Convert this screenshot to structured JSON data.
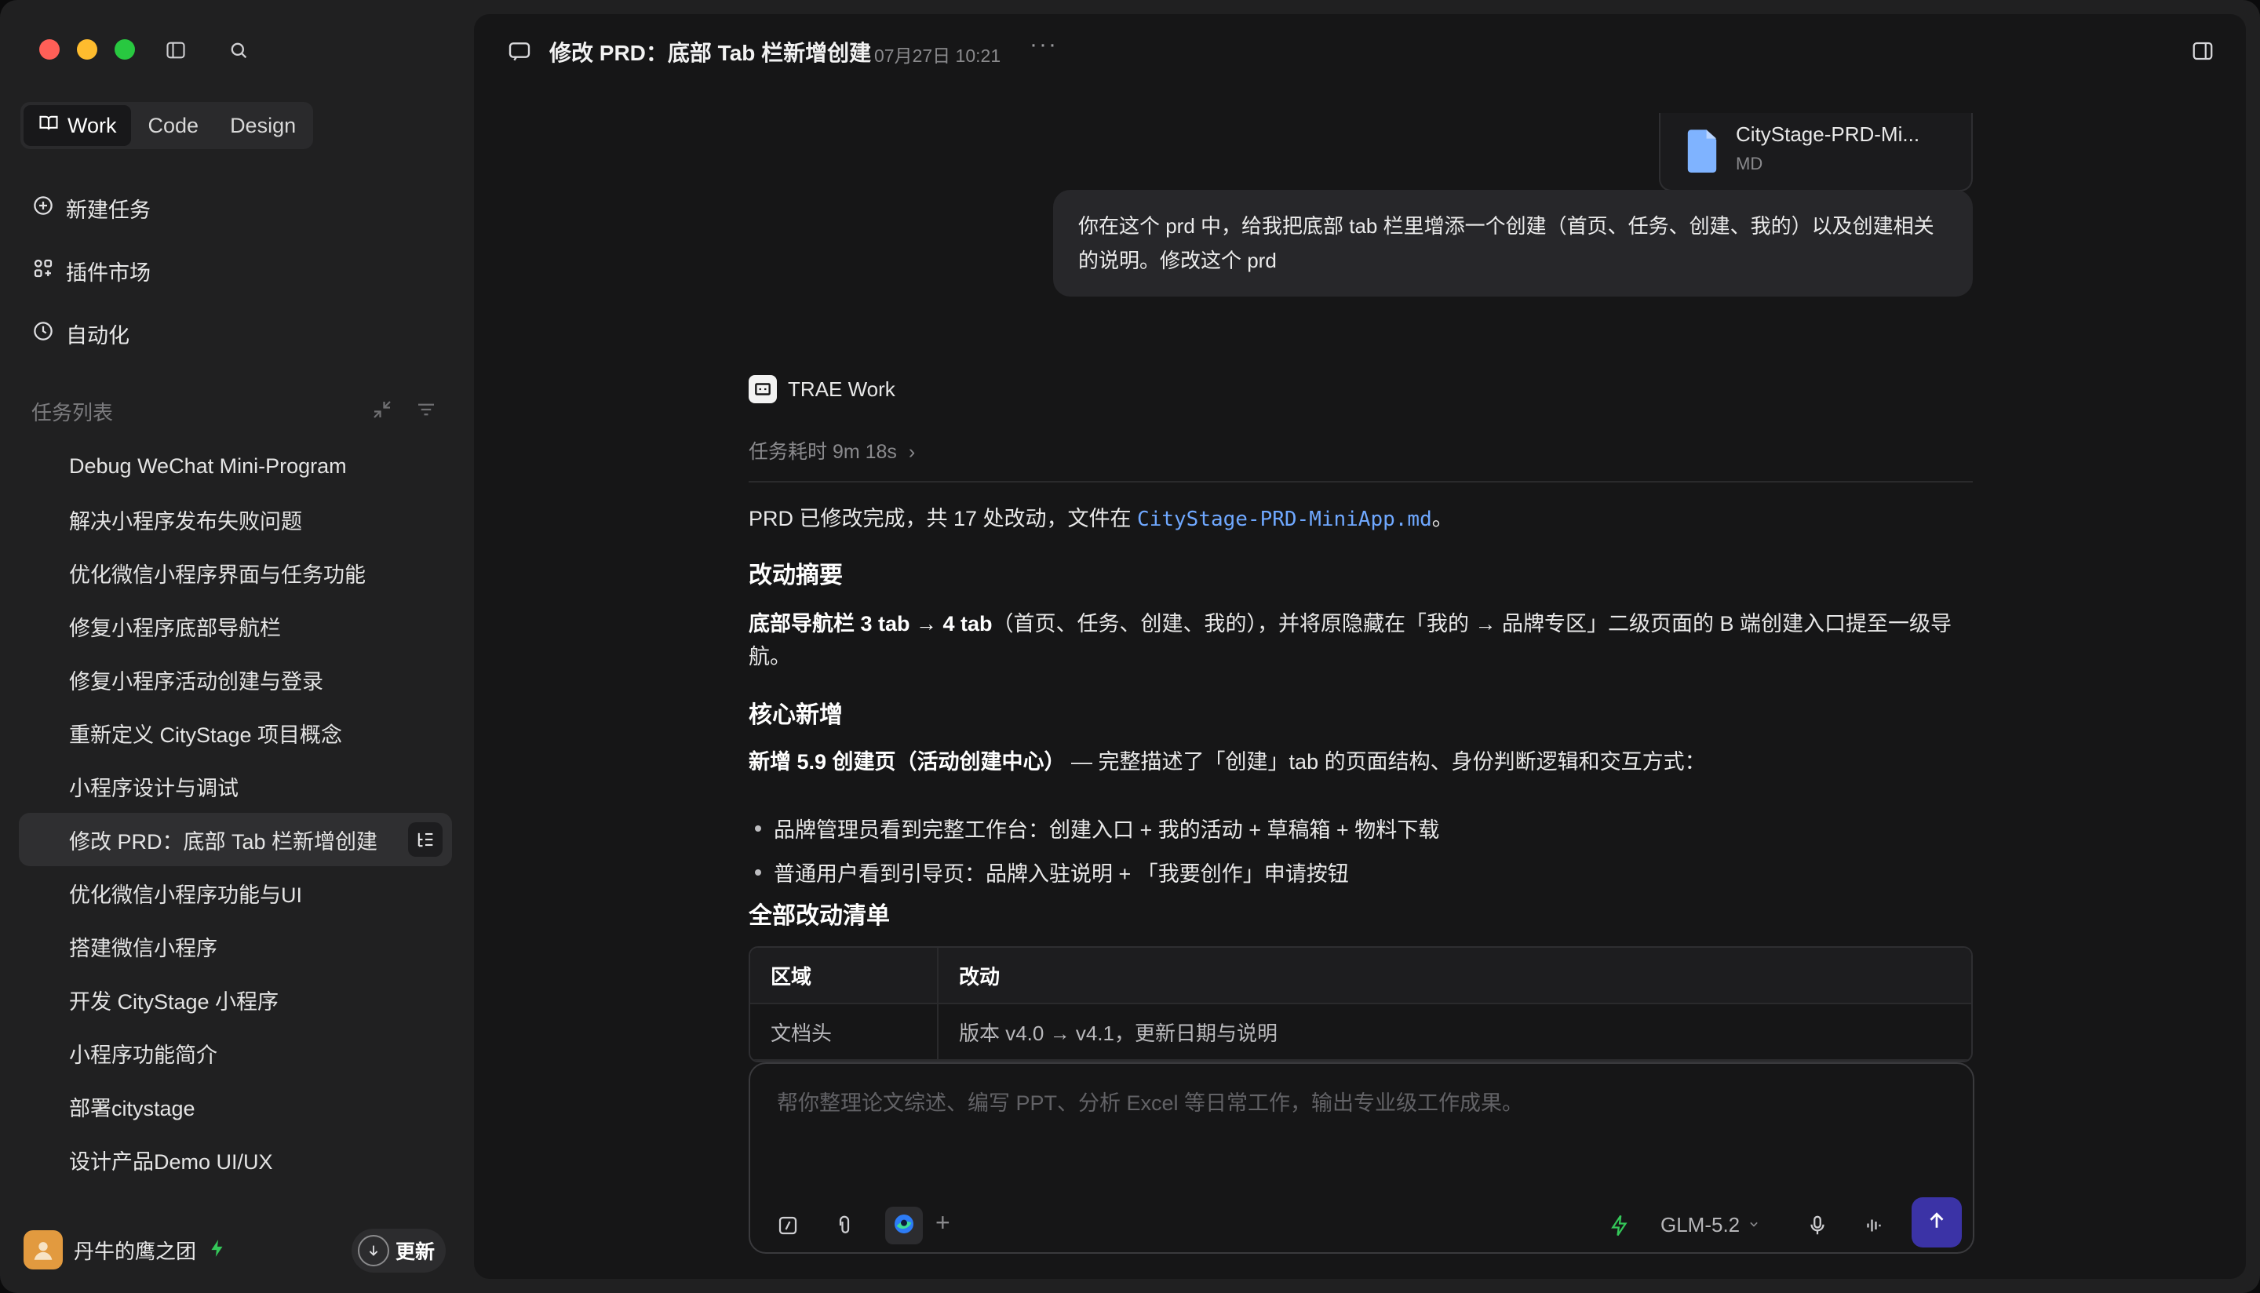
{
  "sidebar": {
    "segments": [
      {
        "label": "Work",
        "icon": "book-icon"
      },
      {
        "label": "Code"
      },
      {
        "label": "Design"
      }
    ],
    "nav": {
      "new_task": "新建任务",
      "plugins": "插件市场",
      "automation": "自动化"
    },
    "section_title": "任务列表",
    "tasks": [
      "Debug WeChat Mini-Program",
      "解决小程序发布失败问题",
      "优化微信小程序界面与任务功能",
      "修复小程序底部导航栏",
      "修复小程序活动创建与登录",
      "重新定义 CityStage 项目概念",
      "小程序设计与调试",
      "修改 PRD：底部 Tab 栏新增创建",
      "优化微信小程序功能与UI",
      "搭建微信小程序",
      "开发 CityStage 小程序",
      "小程序功能简介",
      "部署citystage",
      "设计产品Demo UI/UX"
    ],
    "active_task_index": 7,
    "user": {
      "name": "丹牛的鹰之团"
    },
    "update_label": "更新"
  },
  "header": {
    "title": "修改 PRD：底部 Tab 栏新增创建",
    "time": "07月27日 10:21",
    "more": "···"
  },
  "attachment": {
    "name": "CityStage-PRD-Mi...",
    "type": "MD"
  },
  "user_message": "你在这个 prd 中，给我把底部 tab 栏里增添一个创建（首页、任务、创建、我的）以及创建相关的说明。修改这个 prd",
  "assistant": {
    "name": "TRAE Work",
    "duration": "任务耗时 9m 18s",
    "summary_pre": "PRD 已修改完成，共 17 处改动，文件在 ",
    "summary_file": "CityStage-PRD-MiniApp.md",
    "summary_post": "。",
    "h1": "改动摘要",
    "p1_bold": "底部导航栏 3 tab → 4 tab",
    "p1_rest": "（首页、任务、创建、我的），并将原隐藏在「我的 → 品牌专区」二级页面的 B 端创建入口提至一级导航。",
    "h2": "核心新增",
    "p2_bold": "新增 5.9 创建页（活动创建中心）",
    "p2_rest": " — 完整描述了「创建」tab 的页面结构、身份判断逻辑和交互方式：",
    "bullets": [
      "品牌管理员看到完整工作台：创建入口 + 我的活动 + 草稿箱 + 物料下载",
      "普通用户看到引导页：品牌入驻说明 + 「我要创作」申请按钮"
    ],
    "h3": "全部改动清单",
    "table": {
      "headers": [
        "区域",
        "改动"
      ],
      "rows": [
        [
          "文档头",
          "版本 v4.0 → v4.1，更新日期与说明"
        ]
      ]
    }
  },
  "composer": {
    "placeholder": "帮你整理论文综述、编写 PPT、分析 Excel 等日常工作，输出专业级工作成果。",
    "model": "GLM-5.2",
    "plus": "+"
  },
  "colors": {
    "accent": "#3b33a6",
    "link": "#6fa8ff",
    "file_icon": "#7fb3ff",
    "bolt": "#34c759"
  }
}
